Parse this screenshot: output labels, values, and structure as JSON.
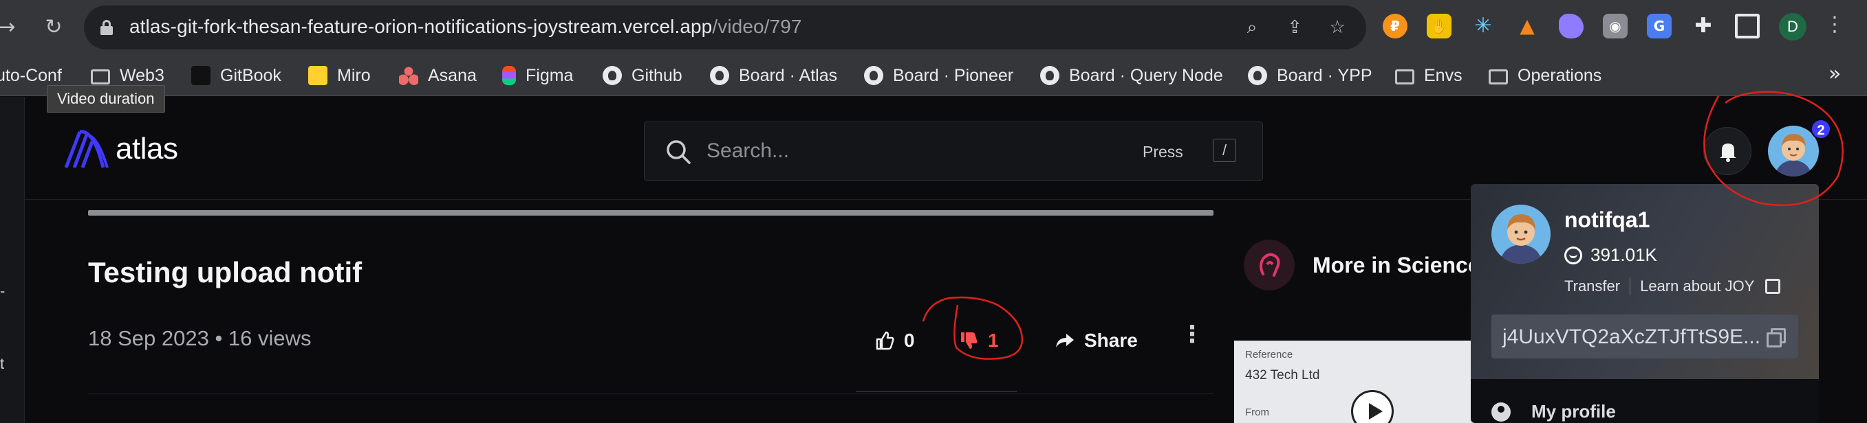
{
  "browser": {
    "url_host": "atlas-git-fork-thesan-feature-orion-notifications-joystream.vercel.app",
    "url_path": "/video/797",
    "profile_initial": "D",
    "extension_icons": [
      "paw-extension-icon",
      "hand-extension-icon",
      "asterisk-extension-icon",
      "metamask-fox-icon",
      "whale-extension-icon",
      "camera-extension-icon",
      "translate-extension-icon",
      "puzzle-extensions-icon",
      "sidepanel-icon"
    ]
  },
  "bookmarks": [
    {
      "label": "uto-Conf",
      "icon": "none"
    },
    {
      "label": "Web3",
      "icon": "folder-icon"
    },
    {
      "label": "GitBook",
      "icon": "gitbook-icon"
    },
    {
      "label": "Miro",
      "icon": "miro-icon"
    },
    {
      "label": "Asana",
      "icon": "asana-icon"
    },
    {
      "label": "Figma",
      "icon": "figma-icon"
    },
    {
      "label": "Github",
      "icon": "github-icon"
    },
    {
      "label": "Board · Atlas",
      "icon": "github-icon"
    },
    {
      "label": "Board · Pioneer",
      "icon": "github-icon"
    },
    {
      "label": "Board · Query Node",
      "icon": "github-icon"
    },
    {
      "label": "Board · YPP",
      "icon": "github-icon"
    },
    {
      "label": "Envs",
      "icon": "folder-icon"
    },
    {
      "label": "Operations",
      "icon": "folder-icon"
    }
  ],
  "bookmarks_overflow": "»",
  "tooltip": "Video duration",
  "left_edge_chars": [
    "-",
    "t"
  ],
  "site": {
    "logo_text": "atlas",
    "search": {
      "placeholder": "Search...",
      "press_label": "Press",
      "shortcut": "/"
    },
    "notification_badge": "2"
  },
  "video": {
    "title": "Testing upload notif",
    "meta": "18 Sep 2023 • 16 views",
    "likes": "0",
    "dislikes": "1",
    "share_label": "Share",
    "more": "⋮"
  },
  "sidebar": {
    "more_in_label": "More in Science",
    "thumbnail": {
      "reference_label": "Reference",
      "reference_value": "432 Tech Ltd",
      "from_label": "From"
    }
  },
  "member_dropdown": {
    "handle": "notifqa1",
    "balance": "391.01K",
    "transfer_label": "Transfer",
    "learn_label": "Learn about JOY",
    "address": "j4UuxVTQ2aXcZTJfTtS9E...",
    "menu_items": [
      {
        "label": "My profile"
      }
    ]
  },
  "colors": {
    "accent": "#4038ff",
    "dislike": "#ff4f4f",
    "annotation": "#e0201e",
    "background": "#0b0b0d"
  }
}
